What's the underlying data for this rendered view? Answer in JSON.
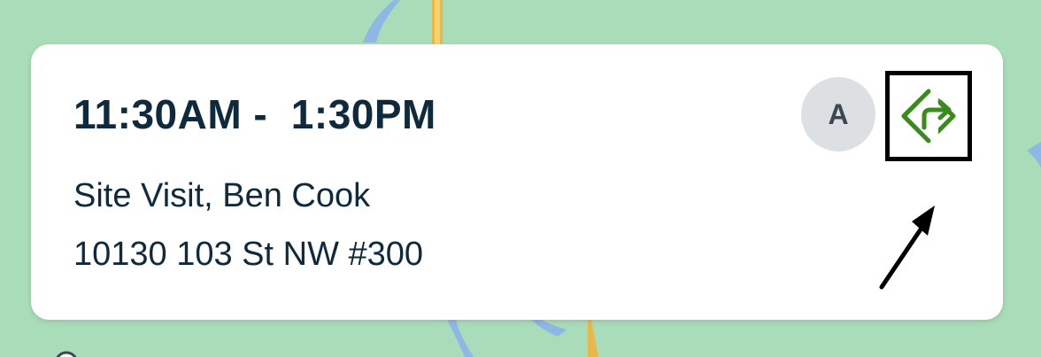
{
  "appointment": {
    "time_range": "11:30AM -  1:30PM",
    "title": "Site Visit, Ben Cook",
    "address": "10130 103 St NW #300"
  },
  "avatar": {
    "initial": "A"
  },
  "directions_button": {
    "icon": "directions-icon"
  },
  "colors": {
    "map_background": "#a9dcb8",
    "text_primary": "#0f2a3c",
    "avatar_background": "#dde0e3",
    "directions_icon": "#3a8a1e",
    "road": "#f1c24a",
    "water": "#8fb7e6"
  }
}
